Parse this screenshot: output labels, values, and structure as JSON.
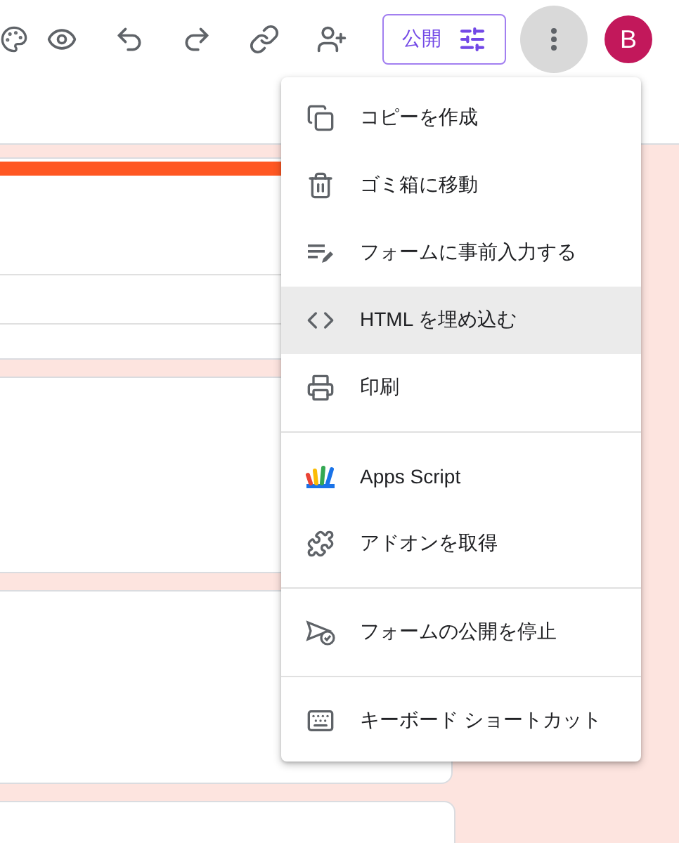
{
  "toolbar": {
    "publish_button": {
      "label": "公開"
    },
    "avatar": {
      "initial": "B"
    },
    "more_button": {
      "pressed": true
    }
  },
  "menu": {
    "groups": [
      [
        {
          "label": "コピーを作成",
          "selected": false
        },
        {
          "label": "ゴミ箱に移動",
          "selected": false
        },
        {
          "label": "フォームに事前入力する",
          "selected": false
        },
        {
          "label": "HTML を埋め込む",
          "selected": true
        },
        {
          "label": "印刷",
          "selected": false
        }
      ],
      [
        {
          "label": "Apps Script",
          "selected": false
        },
        {
          "label": "アドオンを取得",
          "selected": false
        }
      ],
      [
        {
          "label": "フォームの公開を停止",
          "selected": false
        }
      ],
      [
        {
          "label": "キーボード ショートカット",
          "selected": false
        }
      ]
    ]
  }
}
